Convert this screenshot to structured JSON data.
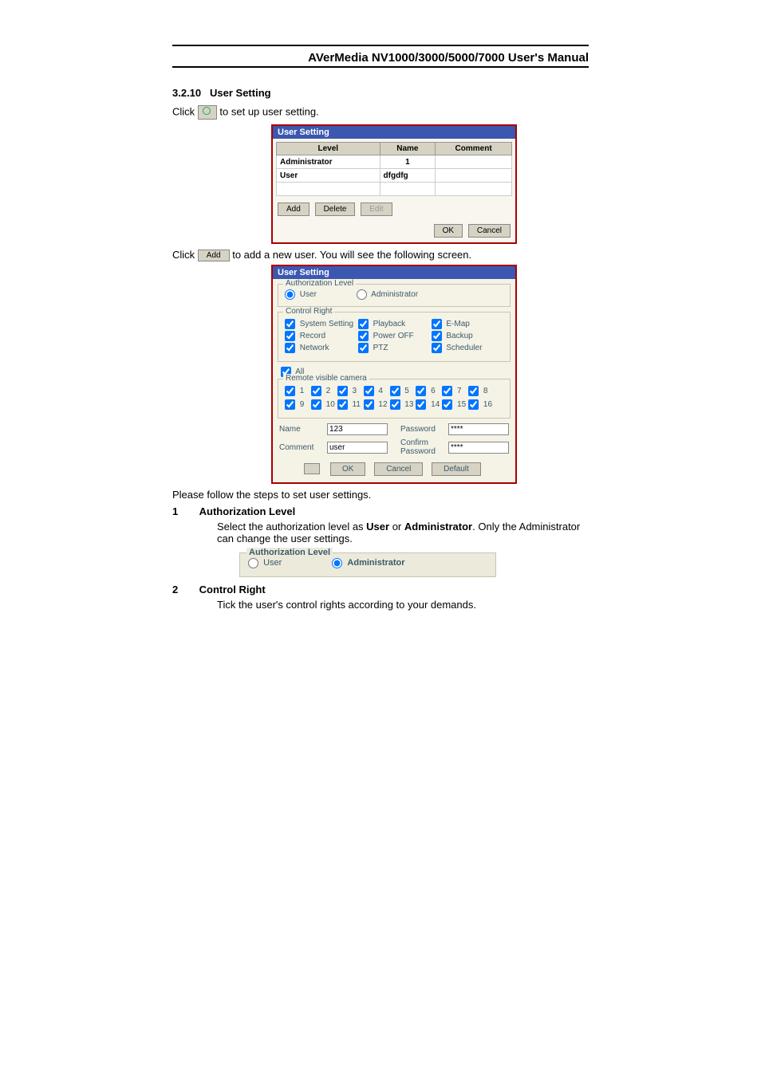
{
  "header": {
    "title": "AVerMedia NV1000/3000/5000/7000 User's Manual"
  },
  "section": {
    "number": "3.2.10",
    "name": "User Setting"
  },
  "body": {
    "click1_prefix": "Click ",
    "click1_suffix": " to set up user setting.",
    "click2_prefix": "Click ",
    "click2_suffix": " to add a new user. You will see the following screen.",
    "add_btn_label": "Add",
    "follow_steps": "Please follow the steps to set user settings."
  },
  "dlg1": {
    "title": "User Setting",
    "cols": [
      "Level",
      "Name",
      "Comment"
    ],
    "rows": [
      {
        "level": "Administrator",
        "name": "1",
        "comment": ""
      },
      {
        "level": "User",
        "name": "dfgdfg",
        "comment": ""
      }
    ],
    "buttons": {
      "add": "Add",
      "delete": "Delete",
      "edit": "Edit",
      "ok": "OK",
      "cancel": "Cancel"
    }
  },
  "dlg2": {
    "title": "User Setting",
    "auth": {
      "legend": "Authorization Level",
      "user": "User",
      "admin": "Administrator"
    },
    "ctrl": {
      "legend": "Control Right",
      "items": [
        "System Setting",
        "Record",
        "Network",
        "Playback",
        "Power OFF",
        "PTZ",
        "E-Map",
        "Backup",
        "Scheduler"
      ]
    },
    "all": "All",
    "rvc": {
      "legend": "Remote visible camera",
      "cams": [
        "1",
        "2",
        "3",
        "4",
        "5",
        "6",
        "7",
        "8",
        "9",
        "10",
        "11",
        "12",
        "13",
        "14",
        "15",
        "16"
      ]
    },
    "labels": {
      "name": "Name",
      "comment": "Comment",
      "password": "Password",
      "confirm": "Confirm Password"
    },
    "values": {
      "name": "123",
      "comment": "user",
      "password": "****",
      "confirm": "****"
    },
    "buttons": {
      "ok": "OK",
      "cancel": "Cancel",
      "default": "Default"
    }
  },
  "steps": {
    "s1": {
      "num": "1",
      "title": "Authorization Level",
      "body": "Select the authorization level as User or Administrator. Only the Administrator can change the user settings.",
      "body_prefix": "Select the authorization level as ",
      "body_user": "User",
      "body_or": " or ",
      "body_admin": "Administrator",
      "body_suffix": ". Only the Administrator can change the user settings."
    },
    "s2": {
      "num": "2",
      "title": "Control Right",
      "body": "Tick the user's control rights according to your demands."
    }
  },
  "auth_snip": {
    "legend": "Authorization Level",
    "user": "User",
    "admin": "Administrator"
  }
}
